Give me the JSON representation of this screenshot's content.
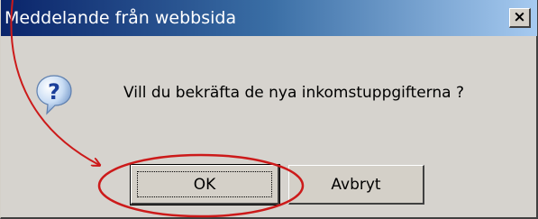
{
  "dialog": {
    "title": "Meddelande från webbsida",
    "close_symbol": "×",
    "message": "Vill du bekräfta de nya inkomstuppgifterna ?",
    "icon": "question-icon"
  },
  "buttons": {
    "ok_label": "OK",
    "cancel_label": "Avbryt"
  },
  "annotation": {
    "color": "#cc1a1a"
  }
}
